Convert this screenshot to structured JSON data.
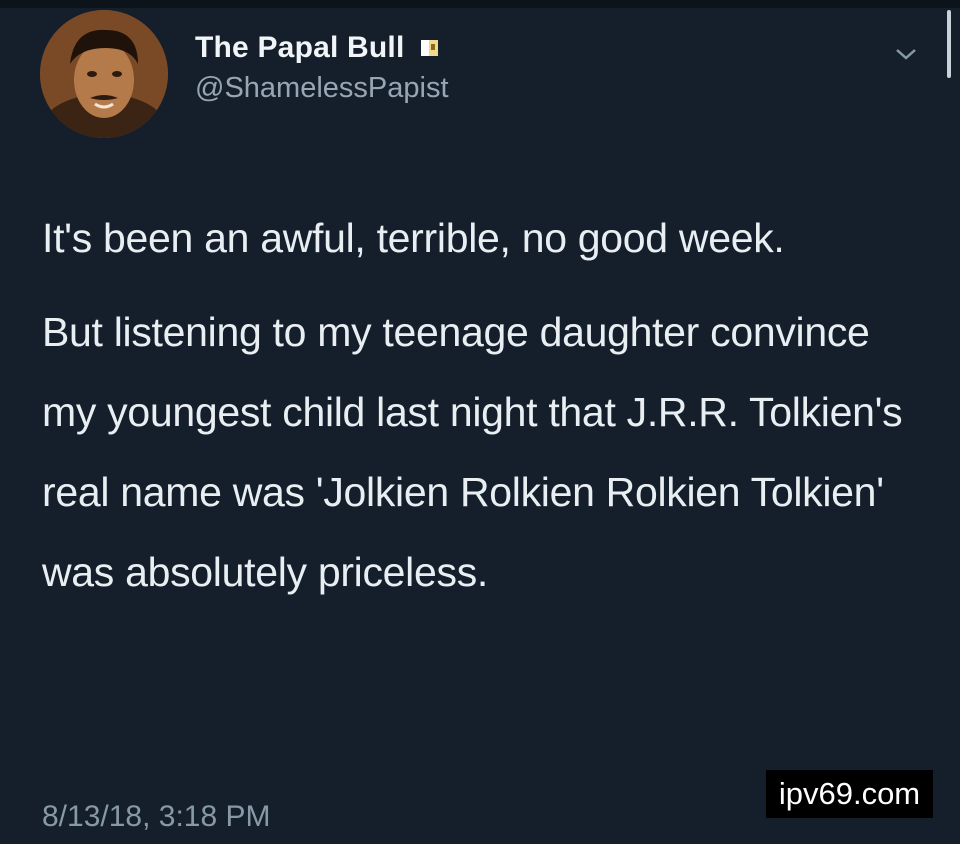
{
  "tweet": {
    "display_name": "The Papal Bull",
    "handle": "@ShamelessPapist",
    "paragraphs": [
      "It's been an awful, terrible, no good week.",
      "But listening to my teenage daughter convince my youngest child last night that J.R.R. Tolkien's real name was 'Jolkien Rolkien Rolkien Tolkien' was absolutely priceless."
    ],
    "timestamp": "8/13/18, 3:18 PM",
    "icons": {
      "badge": "papal-bull-flag-icon",
      "menu": "chevron-down-icon"
    }
  },
  "watermark": {
    "text": "ipv69.com"
  },
  "colors": {
    "background": "#151f2b",
    "text": "#e9eef2",
    "secondary_text": "#8899a6"
  }
}
